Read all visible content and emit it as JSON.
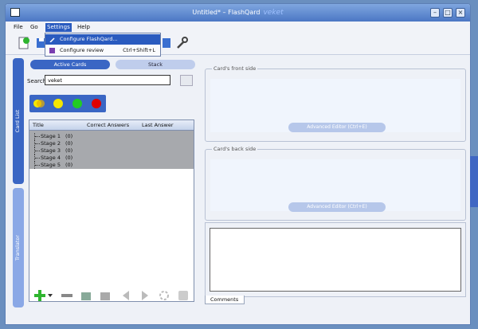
{
  "window": {
    "title": "Untitled* – FlashQard",
    "watermark": "veket"
  },
  "menu": {
    "file": "File",
    "go": "Go",
    "settings": "Settings",
    "help": "Help"
  },
  "settings_menu": {
    "configure_flashqard": "Configure FlashQard...",
    "configure_review": "Configure review",
    "configure_review_shortcut": "Ctrl+Shift+L"
  },
  "side_tabs": {
    "card_list": "Card List",
    "translator": "Translator"
  },
  "card_list": {
    "tab_active": "Active Cards",
    "tab_stack": "Stack",
    "search_label": "Search",
    "search_value": "veket"
  },
  "table": {
    "columns": [
      "Title",
      "Correct Answers",
      "Last Answer"
    ],
    "rows": [
      {
        "title": "Stage 1",
        "count": "(0)"
      },
      {
        "title": "Stage 2",
        "count": "(0)"
      },
      {
        "title": "Stage 3",
        "count": "(0)"
      },
      {
        "title": "Stage 4",
        "count": "(0)"
      },
      {
        "title": "Stage 5",
        "count": "(0)"
      }
    ]
  },
  "front": {
    "legend": "Card's front side",
    "advanced": "Advanced Editor  (Ctrl+E)"
  },
  "back": {
    "legend": "Card's back side",
    "advanced": "Advanced Editor  (Ctrl+E)"
  },
  "comments": {
    "tab": "Comments"
  },
  "colors": {
    "accent": "#3a66c4",
    "highlight": "#2a5bbf",
    "stage_yellow": "#f5e600",
    "stage_green": "#22cc22",
    "stage_red": "#e00000"
  }
}
